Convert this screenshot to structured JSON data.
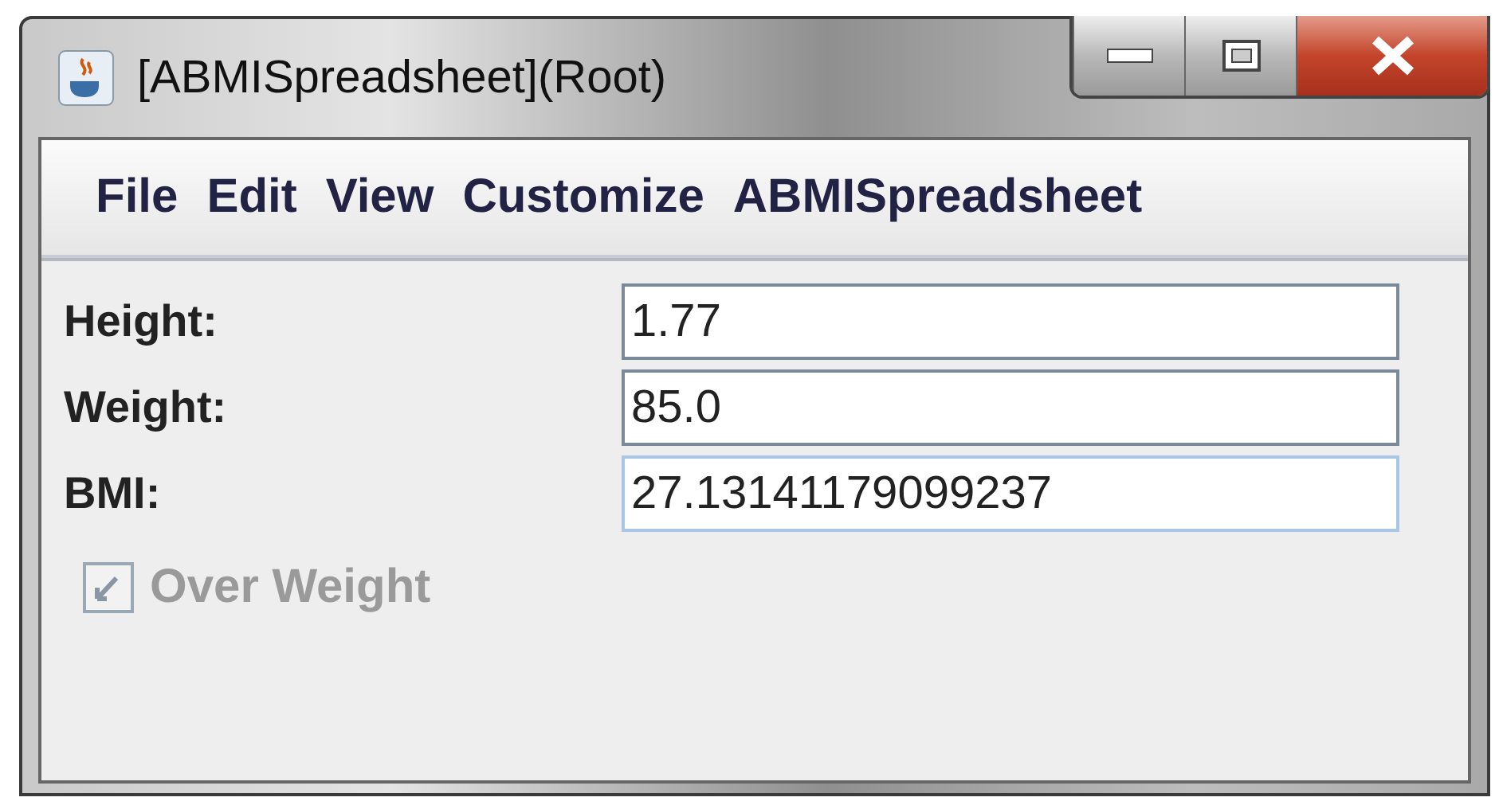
{
  "window": {
    "title": "[ABMISpreadsheet](Root)"
  },
  "menu": [
    "File",
    "Edit",
    "View",
    "Customize",
    "ABMISpreadsheet"
  ],
  "fields": [
    {
      "label": "Height:",
      "value": "1.77",
      "focused": false
    },
    {
      "label": "Weight:",
      "value": "85.0",
      "focused": false
    },
    {
      "label": "BMI:",
      "value": "27.13141179099237",
      "focused": true
    }
  ],
  "checkbox": {
    "label": "Over Weight",
    "checked": true,
    "disabled": true
  }
}
